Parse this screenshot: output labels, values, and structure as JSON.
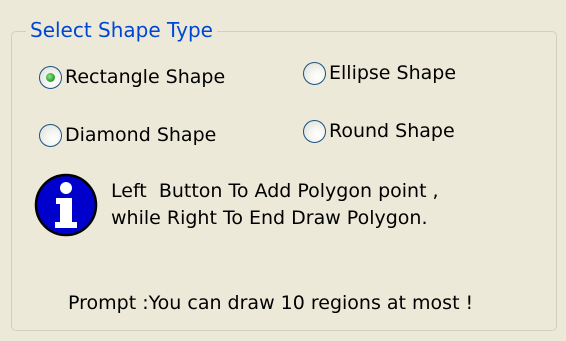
{
  "group": {
    "title": "Select Shape Type"
  },
  "radios": [
    {
      "label": "Rectangle Shape",
      "checked": true
    },
    {
      "label": "Ellipse Shape",
      "checked": false
    },
    {
      "label": "Diamond Shape",
      "checked": false
    },
    {
      "label": "Round Shape",
      "checked": false
    }
  ],
  "info": {
    "icon": "info-icon",
    "line1": "Left  Button To Add Polygon point ,",
    "line2": "while Right To End Draw Polygon."
  },
  "prompt": "Prompt :You can draw 10 regions at most !",
  "colors": {
    "legend_text": "#0046d5",
    "background": "#ece9d8",
    "radio_checked_dot": "#2fa62f",
    "info_icon_fill": "#0000cc"
  }
}
